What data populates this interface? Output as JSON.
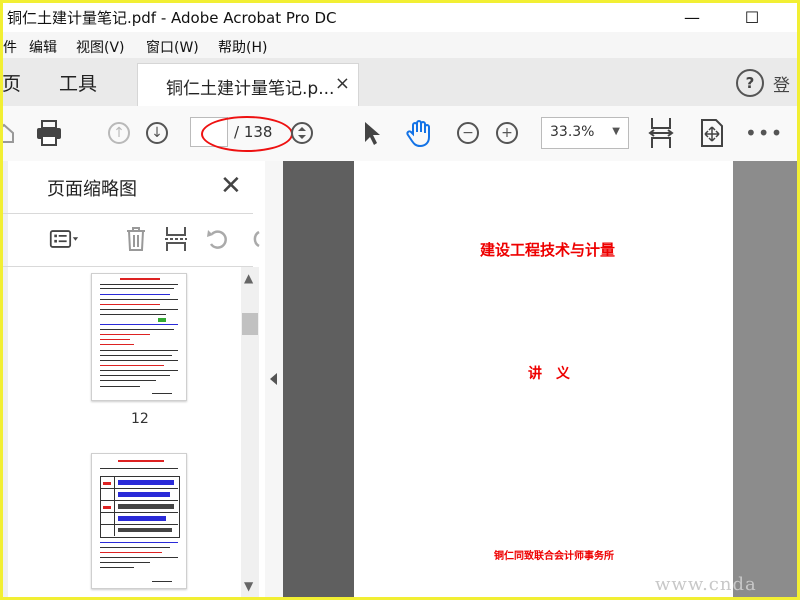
{
  "window": {
    "title": "铜仁土建计量笔记.pdf - Adobe Acrobat Pro DC",
    "minimize": "—",
    "maximize": "☐"
  },
  "menu": [
    "件",
    "编辑",
    "视图(V)",
    "窗口(W)",
    "帮助(H)"
  ],
  "tabs": {
    "home": "主页",
    "tools": "工具",
    "document": "铜仁土建计量笔记.p...",
    "close": "×",
    "help": "?",
    "signin": "登"
  },
  "toolbar": {
    "page_total": "/ 138",
    "zoom": "33.3%",
    "more": "•••"
  },
  "panel": {
    "title": "页面缩略图",
    "close": "✕",
    "thumbnails": [
      {
        "label": "12"
      },
      {
        "label": ""
      }
    ]
  },
  "document_page": {
    "title": "建设工程技术与计量",
    "subtitle": "讲　义",
    "footer": "铜仁同致联合会计师事务所"
  },
  "watermark": "www.cnda",
  "colors": {
    "frame": "#f2ef33",
    "annotation": "#e11111",
    "page_text": "#ee0000",
    "viewer_bg": "#8c8c8c"
  },
  "icons": [
    "home-icon",
    "print-icon",
    "up-arrow-icon",
    "down-arrow-icon",
    "page-stepper-icon",
    "select-cursor-icon",
    "hand-tool-icon",
    "zoom-out-icon",
    "zoom-in-icon",
    "fit-page-icon",
    "full-screen-icon",
    "thumbnail-options-icon",
    "delete-icon",
    "insert-page-icon",
    "rotate-ccw-icon",
    "rotate-cw-icon",
    "collapse-arrow-icon"
  ]
}
